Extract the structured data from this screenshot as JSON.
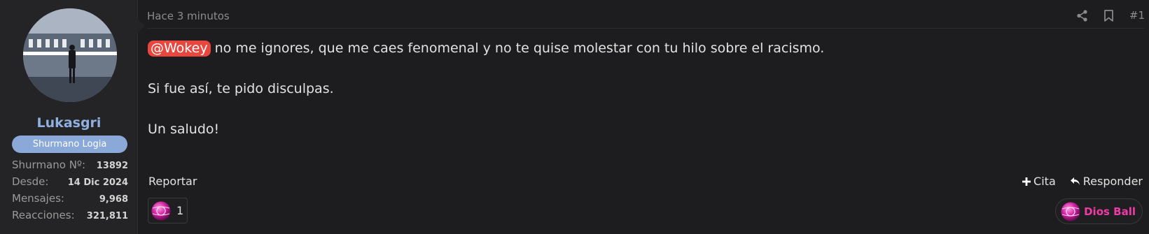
{
  "user": {
    "name": "Lukasgri",
    "title": "Shurmano Logia",
    "stats": [
      {
        "label": "Shurmano Nº:",
        "value": "13892"
      },
      {
        "label": "Desde:",
        "value": "14 Dic 2024"
      },
      {
        "label": "Mensajes:",
        "value": "9,968"
      },
      {
        "label": "Reacciones:",
        "value": "321,811"
      }
    ]
  },
  "post": {
    "time": "Hace 3 minutos",
    "number": "#1",
    "mention": "@Wokey",
    "line1_rest": " no me ignores, que me caes fenomenal y no te quise molestar con tu hilo sobre el racismo.",
    "line2": "Si fue así, te pido disculpas.",
    "line3": "Un saludo!"
  },
  "actions": {
    "report": "Reportar",
    "quote": "Cita",
    "reply": "Responder"
  },
  "reactions": {
    "count": "1",
    "badge_label": "Dios Ball"
  },
  "colors": {
    "background": "#1d1d1f",
    "user_panel": "#242426",
    "username": "#8fb0e0",
    "user_title_bg": "#8aa8d8",
    "mention_bg": "#e8473f",
    "badge_text": "#ef3ba6"
  },
  "icons": {
    "share": "share-icon",
    "bookmark": "bookmark-icon",
    "quote": "plus-icon",
    "reply": "reply-arrow-icon",
    "reaction": "dios-ball-icon"
  }
}
